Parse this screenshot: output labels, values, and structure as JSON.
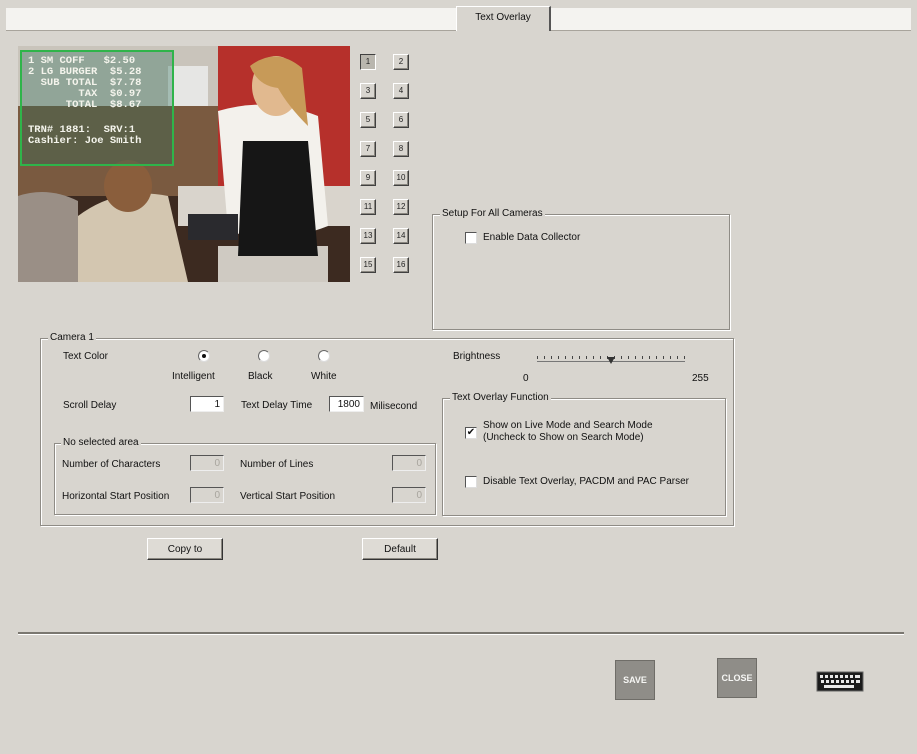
{
  "tab": {
    "label": "Text Overlay"
  },
  "preview": {
    "receipt_lines": [
      "1 SM COFF   $2.50",
      "2 LG BURGER  $5.28",
      "  SUB TOTAL  $7.78",
      "        TAX  $0.97",
      "      TOTAL  $8.67",
      "",
      "TRN# 1881:  SRV:1",
      "Cashier: Joe Smith"
    ]
  },
  "cameras": [
    "1",
    "2",
    "3",
    "4",
    "5",
    "6",
    "7",
    "8",
    "9",
    "10",
    "11",
    "12",
    "13",
    "14",
    "15",
    "16"
  ],
  "selected_camera_index": 0,
  "setup_all": {
    "title": "Setup For All Cameras",
    "enable_data_collector": {
      "label": "Enable Data Collector",
      "checked": false
    }
  },
  "camera_group": {
    "title": "Camera 1",
    "text_color_label": "Text Color",
    "text_colors": [
      {
        "label": "Intelligent",
        "selected": true
      },
      {
        "label": "Black",
        "selected": false
      },
      {
        "label": "White",
        "selected": false
      }
    ],
    "scroll_delay_label": "Scroll Delay",
    "scroll_delay_value": "1",
    "text_delay_label": "Text Delay Time",
    "text_delay_value": "1800",
    "text_delay_unit": "Milisecond",
    "brightness_label": "Brightness",
    "brightness_min": "0",
    "brightness_max": "255",
    "brightness_value": 128,
    "no_area": {
      "title": "No selected area",
      "num_chars_label": "Number of Characters",
      "num_chars_value": "0",
      "num_lines_label": "Number of Lines",
      "num_lines_value": "0",
      "hstart_label": "Horizontal Start Position",
      "hstart_value": "0",
      "vstart_label": "Vertical Start Position",
      "vstart_value": "0"
    },
    "overlay_function": {
      "title": "Text Overlay Function",
      "show_live_line1": "Show on Live Mode  and Search Mode",
      "show_live_line2": "(Uncheck to Show on Search Mode)",
      "show_live_checked": true,
      "disable_label": "Disable Text Overlay, PACDM and PAC Parser",
      "disable_checked": false
    }
  },
  "buttons": {
    "copy_to": "Copy to",
    "default": "Default",
    "save": "SAVE",
    "close": "CLOSE"
  },
  "icons": {
    "keyboard": "keyboard-icon"
  }
}
